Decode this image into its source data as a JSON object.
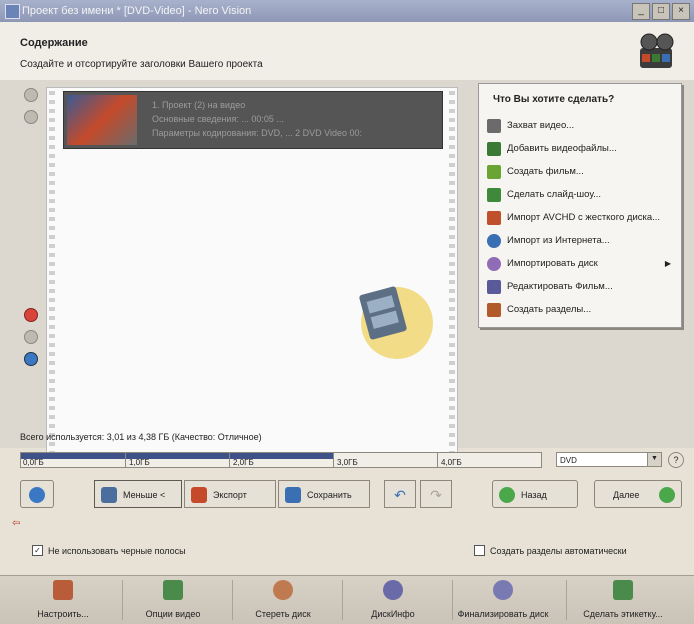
{
  "window": {
    "title": "Проект без имени * [DVD-Video] - Nero Vision",
    "controls": [
      "minimize",
      "maximize",
      "close"
    ]
  },
  "header": {
    "title": "Содержание",
    "subtitle": "Создайте и отсортируйте заголовки Вашего проекта"
  },
  "title_item": {
    "line1": "1. Проект (2) на видео",
    "line2": "Основные сведения: ... 00:05 ...",
    "line3": "Параметры кодирования: DVD, ... 2 DVD Video 00:"
  },
  "menu": {
    "title": "Что Вы хотите сделать?",
    "items": [
      {
        "label": "Захват видео...",
        "icon": "video-camera-icon",
        "color": "#6b6b6b"
      },
      {
        "label": "Добавить видеофайлы...",
        "icon": "add-files-icon",
        "color": "#3a7a35"
      },
      {
        "label": "Создать фильм...",
        "icon": "film-icon",
        "color": "#6aa432"
      },
      {
        "label": "Сделать слайд-шоу...",
        "icon": "slideshow-icon",
        "color": "#3f8a3a"
      },
      {
        "label": "Импорт AVCHD с жесткого диска...",
        "icon": "avchd-icon",
        "color": "#c0502b"
      },
      {
        "label": "Импорт из Интернета...",
        "icon": "globe-icon",
        "color": "#3a6fb3"
      },
      {
        "label": "Импортировать диск",
        "icon": "disc-icon",
        "color": "#8f6cb5",
        "has_submenu": true
      },
      {
        "label": "Редактировать Фильм...",
        "icon": "edit-film-icon",
        "color": "#5a5a9a"
      },
      {
        "label": "Создать разделы...",
        "icon": "chapters-icon",
        "color": "#b35a2a"
      }
    ]
  },
  "usage": {
    "text": "Всего используется: 3,01 из 4,38 ГБ (Качество: Отличное)",
    "used_fraction": 0.6,
    "ticks": [
      "0,0ГБ",
      "1,0ГБ",
      "2,0ГБ",
      "3,0ГБ",
      "4,0ГБ"
    ]
  },
  "disc_select": {
    "value": "DVD"
  },
  "toolbar": {
    "less_label": "Меньше <",
    "export_label": "Экспорт",
    "save_label": "Сохранить",
    "back_label": "Назад",
    "next_label": "Далее"
  },
  "options": {
    "no_black_borders": "Не использовать черные полосы",
    "auto_chapters": "Создать разделы автоматически"
  },
  "bottom": {
    "items": [
      {
        "label": "Настроить...",
        "icon": "settings-icon",
        "color": "#b85c3a"
      },
      {
        "label": "Опции видео",
        "icon": "video-options-icon",
        "color": "#4a8a4a"
      },
      {
        "label": "Стереть диск",
        "icon": "erase-disc-icon",
        "color": "#c07a50"
      },
      {
        "label": "ДискИнфо",
        "icon": "disc-info-icon",
        "color": "#6a6aa8"
      },
      {
        "label": "Финализировать диск",
        "icon": "finalize-disc-icon",
        "color": "#7a7ab3"
      },
      {
        "label": "Сделать этикетку...",
        "icon": "label-icon",
        "color": "#4a8a4a"
      }
    ]
  }
}
